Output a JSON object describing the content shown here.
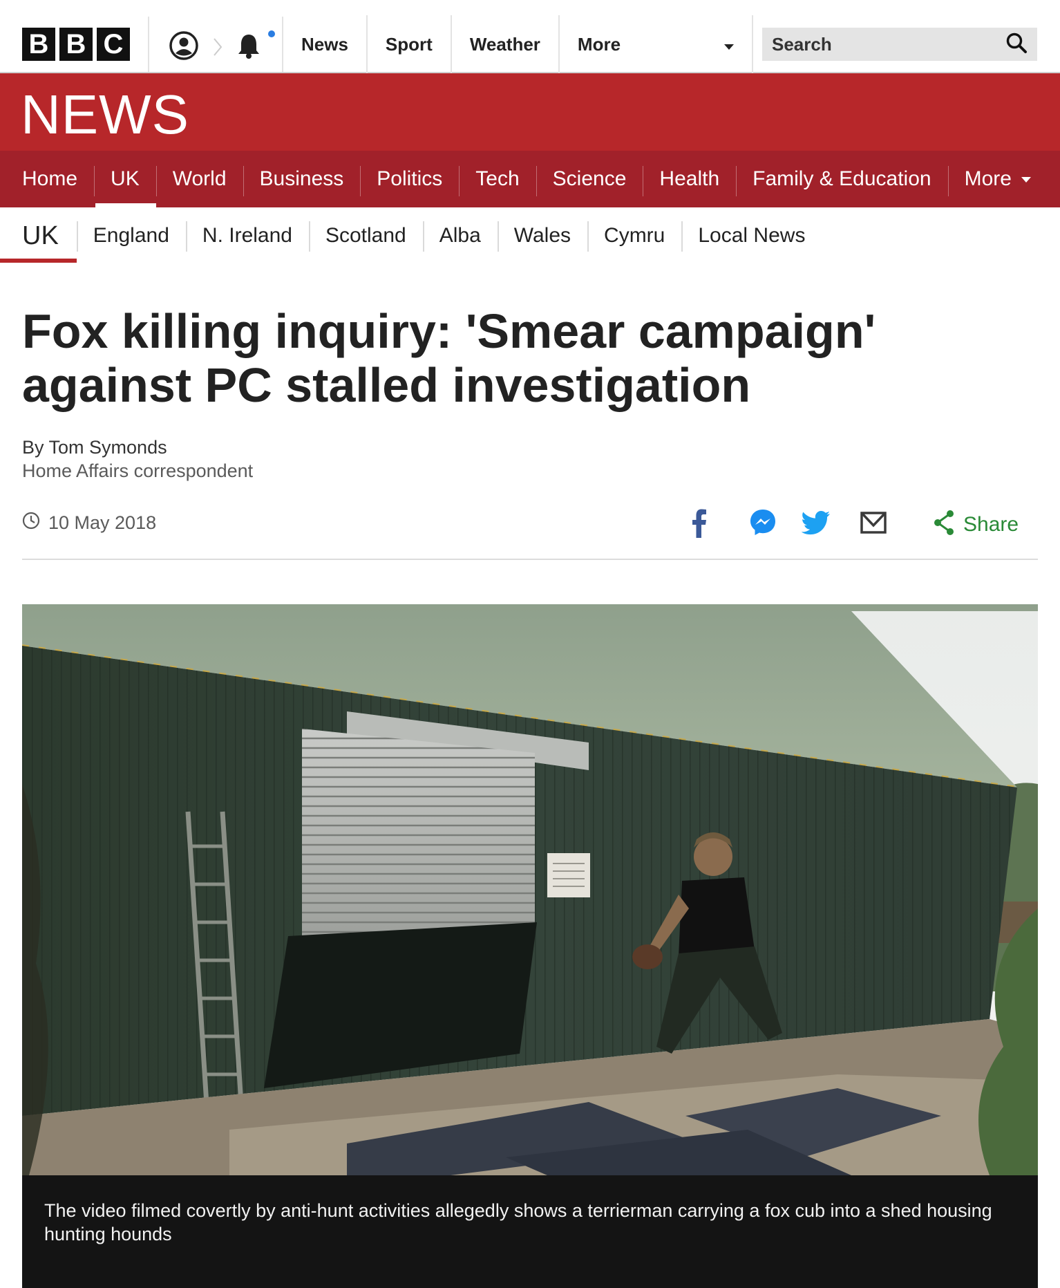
{
  "brand": {
    "logo_letters": [
      "B",
      "B",
      "C"
    ],
    "section_word": "NEWS"
  },
  "top_nav": {
    "items": [
      "News",
      "Sport",
      "Weather"
    ],
    "more_label": "More",
    "search_placeholder": "Search"
  },
  "section_nav": {
    "items": [
      "Home",
      "UK",
      "World",
      "Business",
      "Politics",
      "Tech",
      "Science",
      "Health",
      "Family & Education"
    ],
    "active": "UK",
    "more_label": "More"
  },
  "sub_nav": {
    "current": "UK",
    "items": [
      "England",
      "N. Ireland",
      "Scotland",
      "Alba",
      "Wales",
      "Cymru",
      "Local News"
    ]
  },
  "article": {
    "headline": "Fox killing inquiry: 'Smear campaign' against PC stalled investigation",
    "author": "By Tom Symonds",
    "role": "Home Affairs correspondent",
    "date": "10 May 2018",
    "share_label": "Share",
    "image_caption": "The video filmed covertly by anti-hunt activities allegedly shows a terrierman carrying a fox cub into a shed housing hunting hounds"
  },
  "colors": {
    "news_red": "#b7272a",
    "nav_red": "#a1212a",
    "share_green": "#2a8a37",
    "facebook_blue": "#3b5998",
    "messenger_blue": "#1a8df0",
    "twitter_blue": "#1da1f2",
    "notification_dot": "#2a7de1"
  },
  "icons": [
    "account-icon",
    "chevron-right-icon",
    "bell-icon",
    "chevron-down-icon",
    "search-icon",
    "clock-icon",
    "facebook-icon",
    "messenger-icon",
    "twitter-icon",
    "email-icon",
    "share-icon"
  ]
}
